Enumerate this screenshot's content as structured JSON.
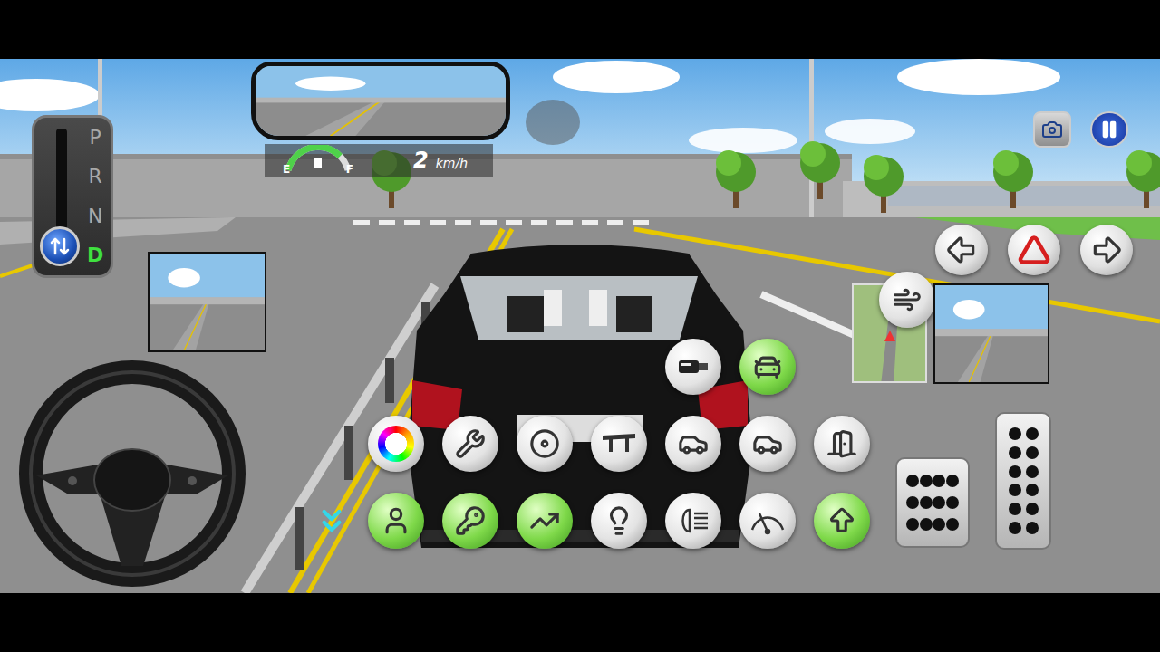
{
  "gear_selector": {
    "gears": [
      {
        "label": "P",
        "selected": false
      },
      {
        "label": "R",
        "selected": false
      },
      {
        "label": "N",
        "selected": false
      },
      {
        "label": "D",
        "selected": true
      }
    ]
  },
  "dashboard": {
    "fuel": {
      "empty_label": "E",
      "full_label": "F",
      "level": 0.8
    },
    "speed": {
      "value": "2",
      "unit": "km/h"
    }
  },
  "top_buttons": [
    {
      "kind": "camera"
    },
    {
      "kind": "pause"
    }
  ],
  "turn_signals": [
    {
      "kind": "left",
      "on": false
    },
    {
      "kind": "hazard",
      "on": false
    },
    {
      "kind": "right",
      "on": false
    }
  ],
  "minimap_button": {
    "kind": "defrost",
    "on": false
  },
  "controls": [
    [
      {
        "kind": "lamp",
        "on": false
      },
      {
        "kind": "beacon",
        "on": true
      }
    ],
    [
      {
        "kind": "paint",
        "on": false
      },
      {
        "kind": "repair",
        "on": false
      },
      {
        "kind": "tire",
        "on": false
      },
      {
        "kind": "spoiler",
        "on": false
      },
      {
        "kind": "trunk",
        "on": false
      },
      {
        "kind": "hood",
        "on": false
      },
      {
        "kind": "door",
        "on": false
      }
    ],
    [
      {
        "kind": "collapse",
        "on": false
      },
      {
        "kind": "seatbelt",
        "on": true
      },
      {
        "kind": "engine-key",
        "on": true
      },
      {
        "kind": "ramp",
        "on": true
      },
      {
        "kind": "low-beam",
        "on": false
      },
      {
        "kind": "high-beam",
        "on": false
      },
      {
        "kind": "wiper",
        "on": false
      },
      {
        "kind": "shift-up",
        "on": true
      }
    ]
  ],
  "pedals": [
    {
      "kind": "brake",
      "pressed": false
    },
    {
      "kind": "accelerator",
      "pressed": false
    }
  ]
}
